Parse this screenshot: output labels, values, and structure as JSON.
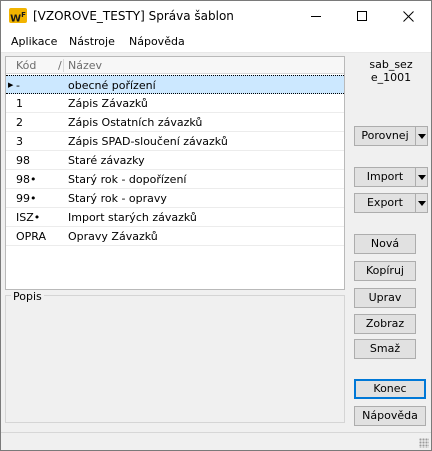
{
  "window": {
    "title": "[VZOROVE_TESTY] Správa šablon",
    "logo_main": "W",
    "logo_sup": "F"
  },
  "menu": [
    "Aplikace",
    "Nástroje",
    "Nápověda"
  ],
  "grid": {
    "columns": {
      "kod": "Kód",
      "sort": "/",
      "nazev": "Název"
    },
    "row_marker": "▶",
    "rows": [
      {
        "kod": "-",
        "nazev": "obecné pořízení"
      },
      {
        "kod": "1",
        "nazev": "Zápis Závazků"
      },
      {
        "kod": "2",
        "nazev": "Zápis Ostatních závazků"
      },
      {
        "kod": "3",
        "nazev": "Zápis SPAD-sloučení závazků"
      },
      {
        "kod": "98",
        "nazev": "Staré závazky"
      },
      {
        "kod": "98•",
        "nazev": "Starý rok - dopořízení"
      },
      {
        "kod": "99•",
        "nazev": "Starý rok - opravy"
      },
      {
        "kod": "ISZ•",
        "nazev": "Import starých závazků"
      },
      {
        "kod": "OPRA",
        "nazev": "Opravy Závazků"
      }
    ]
  },
  "popis": {
    "label": "Popis"
  },
  "side": {
    "code_line1": "sab_sez",
    "code_line2": "e_1001",
    "porovnej": "Porovnej",
    "import": "Import",
    "export": "Export",
    "nova": "Nová",
    "kopiruj": "Kopíruj",
    "uprav": "Uprav",
    "zobraz": "Zobraz",
    "smaz": "Smaž",
    "konec": "Konec",
    "napoveda": "Nápověda"
  },
  "colors": {
    "selection": "#cce8ff",
    "focus_border": "#0078d7",
    "logo": "#f2b400"
  }
}
